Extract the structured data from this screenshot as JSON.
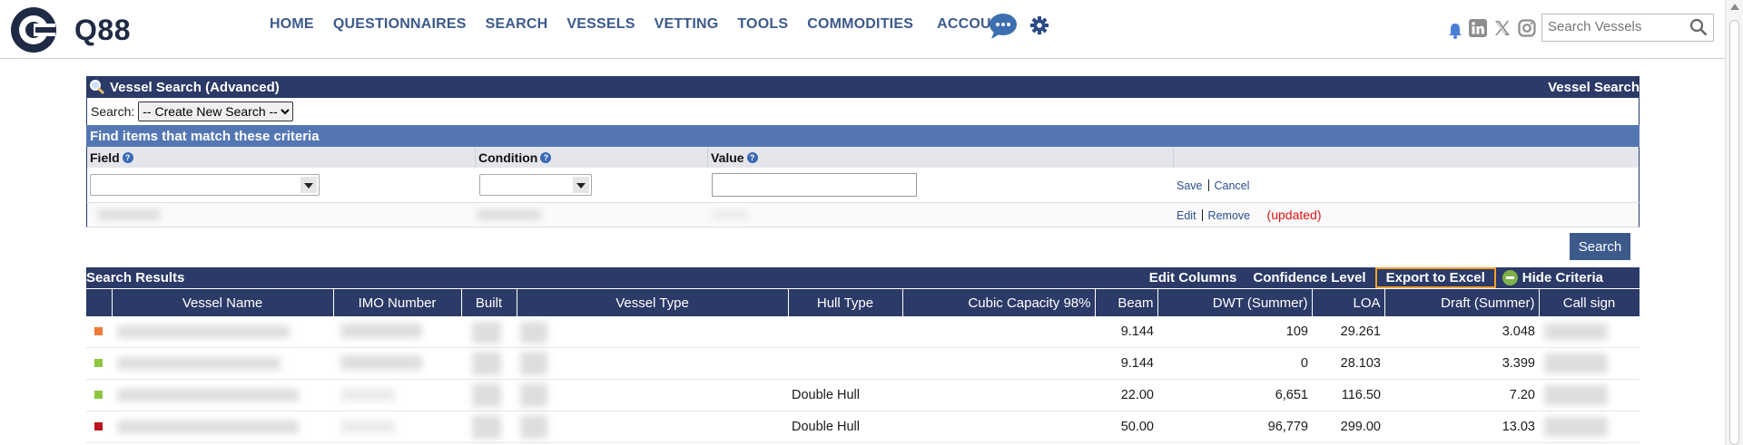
{
  "header": {
    "brand": "Q88",
    "nav": [
      "HOME",
      "QUESTIONNAIRES",
      "SEARCH",
      "VESSELS",
      "VETTING",
      "TOOLS",
      "COMMODITIES",
      "ACCOUNT"
    ],
    "search_placeholder": "Search Vessels",
    "colors": {
      "nav": "#3d5a8c",
      "brand": "#1f2a44"
    }
  },
  "panel": {
    "title": "Vessel Search (Advanced)",
    "title_right": "Vessel Search",
    "search_label": "Search:",
    "search_select_value": "-- Create New Search --",
    "criteria_title": "Find items that match these criteria",
    "columns": {
      "field": "Field",
      "condition": "Condition",
      "value": "Value"
    },
    "actions": {
      "save": "Save",
      "cancel": "Cancel",
      "edit": "Edit",
      "remove": "Remove",
      "updated": "(updated)"
    },
    "search_button": "Search",
    "colors": {
      "header": "#2b3a67",
      "criteria": "#5477b4"
    }
  },
  "results": {
    "title": "Search Results",
    "tools": {
      "edit_columns": "Edit Columns",
      "confidence": "Confidence Level",
      "export": "Export to Excel",
      "hide": "Hide Criteria"
    },
    "columns": [
      "Vessel Name",
      "IMO Number",
      "Built",
      "Vessel Type",
      "Hull Type",
      "Cubic Capacity 98%",
      "Beam",
      "DWT (Summer)",
      "LOA",
      "Draft (Summer)",
      "Call sign"
    ],
    "rows": [
      {
        "flag_color": "#f07a3a",
        "hull": "",
        "beam": "9.144",
        "dwt": "109",
        "loa": "29.261",
        "draft": "3.048"
      },
      {
        "flag_color": "#8cc63f",
        "hull": "",
        "beam": "9.144",
        "dwt": "0",
        "loa": "28.103",
        "draft": "3.399"
      },
      {
        "flag_color": "#8cc63f",
        "hull": "Double Hull",
        "beam": "22.00",
        "dwt": "6,651",
        "loa": "116.50",
        "draft": "7.20"
      },
      {
        "flag_color": "#c0141c",
        "hull": "Double Hull",
        "beam": "50.00",
        "dwt": "96,779",
        "loa": "299.00",
        "draft": "13.03"
      }
    ]
  }
}
